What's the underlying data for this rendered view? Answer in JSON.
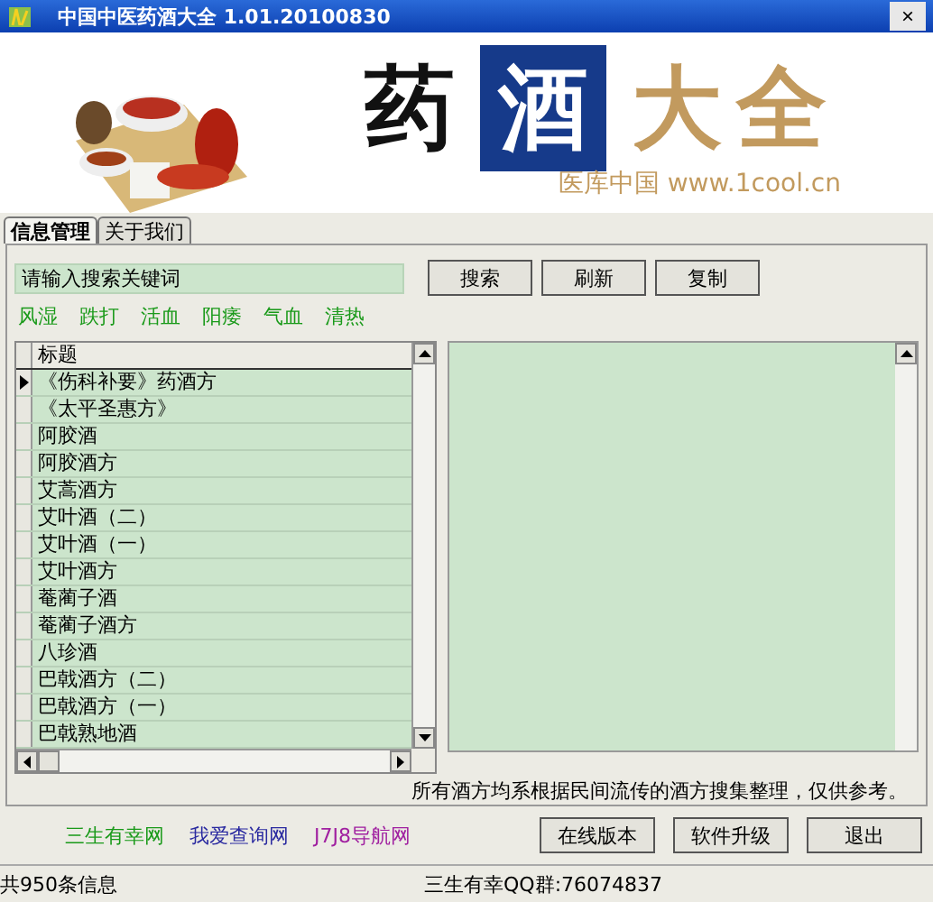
{
  "window": {
    "title": "中国中医药酒大全 1.01.20100830",
    "close": "×"
  },
  "banner": {
    "logo": [
      {
        "text": "药",
        "kind": "plain"
      },
      {
        "text": "酒",
        "kind": "boxed"
      },
      {
        "text": "大全",
        "kind": "gold"
      }
    ],
    "subtitle": "医库中国 www.1cool.cn"
  },
  "tabs": [
    {
      "label": "信息管理",
      "selected": true
    },
    {
      "label": "关于我们",
      "selected": false
    }
  ],
  "search": {
    "value": "请输入搜索关键词"
  },
  "buttons": [
    "搜索",
    "刷新",
    "复制"
  ],
  "categories": [
    "风湿",
    "跌打",
    "活血",
    "阳痿",
    "气血",
    "清热"
  ],
  "grid": {
    "column": "标题",
    "rows": [
      {
        "title": "《伤科补要》药酒方",
        "selected": true
      },
      {
        "title": "《太平圣惠方》",
        "selected": false
      },
      {
        "title": "阿胶酒",
        "selected": false
      },
      {
        "title": "阿胶酒方",
        "selected": false
      },
      {
        "title": "艾蒿酒方",
        "selected": false
      },
      {
        "title": "艾叶酒（二）",
        "selected": false
      },
      {
        "title": "艾叶酒（一）",
        "selected": false
      },
      {
        "title": "艾叶酒方",
        "selected": false
      },
      {
        "title": "菴蔺子酒",
        "selected": false
      },
      {
        "title": "菴蔺子酒方",
        "selected": false
      },
      {
        "title": "八珍酒",
        "selected": false
      },
      {
        "title": "巴戟酒方（二）",
        "selected": false
      },
      {
        "title": "巴戟酒方（一）",
        "selected": false
      },
      {
        "title": "巴戟熟地酒",
        "selected": false
      }
    ]
  },
  "disclaimer": "所有酒方均系根据民间流传的酒方搜集整理，仅供参考。",
  "links": [
    {
      "label": "三生有幸网",
      "color": "#1a9a1a"
    },
    {
      "label": "我爱查询网",
      "color": "#2a2aa0"
    },
    {
      "label": "J7J8导航网",
      "color": "#a020a0"
    }
  ],
  "bottom_buttons": [
    "在线版本",
    "软件升级",
    "退出"
  ],
  "status_bar": [
    "共950条信息",
    "三生有幸QQ群:76074837"
  ]
}
